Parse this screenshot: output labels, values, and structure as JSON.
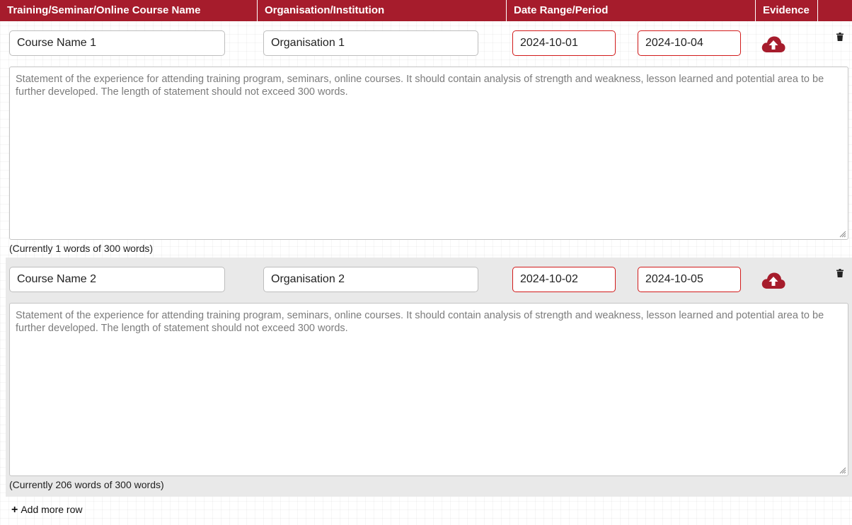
{
  "header": {
    "col_name": "Training/Seminar/Online Course Name",
    "col_org": "Organisation/Institution",
    "col_date": "Date Range/Period",
    "col_evidence": "Evidence"
  },
  "rows": [
    {
      "course_name": "Course Name 1",
      "organisation": "Organisation 1",
      "date_from": "2024-10-01",
      "date_to": "2024-10-04",
      "statement_placeholder": "Statement of the experience for attending training program, seminars, online courses. It should contain analysis of strength and weakness, lesson learned and potential area to be further developed. The length of statement should not exceed 300 words.",
      "word_count": "(Currently 1 words of 300 words)"
    },
    {
      "course_name": "Course Name 2",
      "organisation": "Organisation 2",
      "date_from": "2024-10-02",
      "date_to": "2024-10-05",
      "statement_placeholder": "Statement of the experience for attending training program, seminars, online courses. It should contain analysis of strength and weakness, lesson learned and potential area to be further developed. The length of statement should not exceed 300 words.",
      "word_count": "(Currently 206 words of 300 words)"
    }
  ],
  "add_row_label": "Add more row",
  "add_row_icon": "plus-icon",
  "icons": {
    "upload": "cloud-upload-icon",
    "delete": "trash-icon"
  },
  "colors": {
    "header_bg": "#a61c2c",
    "accent": "#a61c2c",
    "date_border": "#d11a1a",
    "row_alt_bg": "#e9e9e9"
  }
}
